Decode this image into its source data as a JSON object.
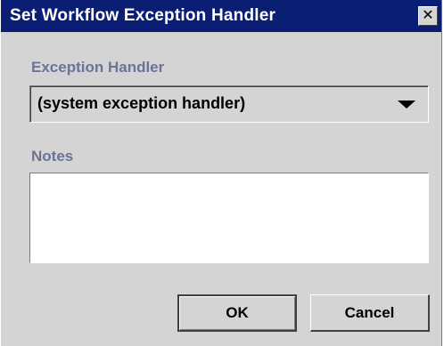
{
  "window": {
    "title": "Set Workflow Exception Handler",
    "close_icon": "close-x"
  },
  "handler": {
    "label": "Exception Handler",
    "selected": "(system exception handler)",
    "arrow_icon": "chevron-down"
  },
  "notes": {
    "label": "Notes",
    "value": ""
  },
  "buttons": {
    "ok": "OK",
    "cancel": "Cancel"
  },
  "colors": {
    "titlebar": "#0a1e73",
    "dialog_bg": "#d4d4d4",
    "label": "#6c7396"
  }
}
